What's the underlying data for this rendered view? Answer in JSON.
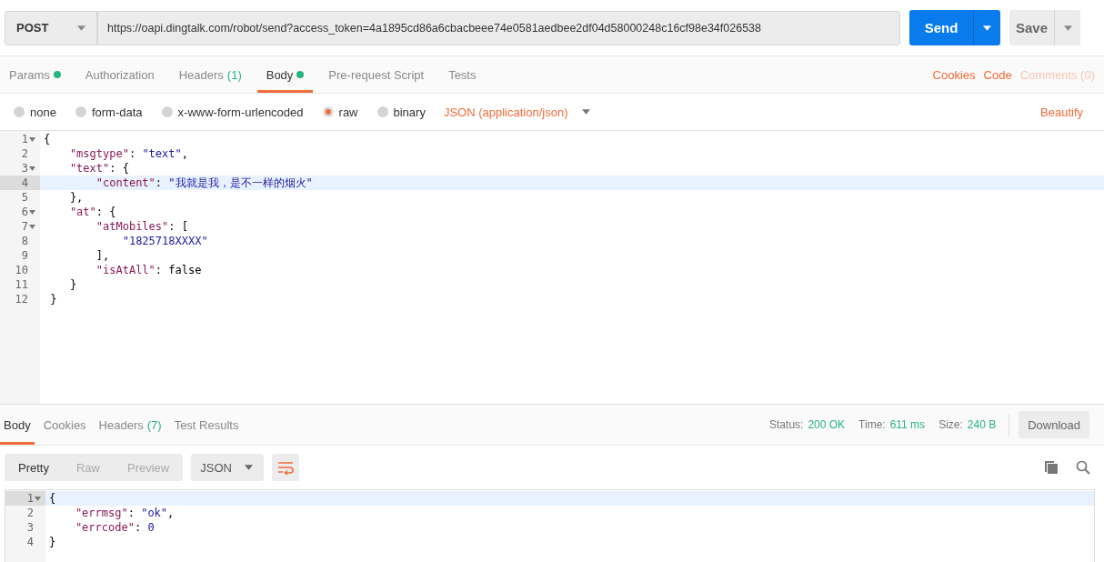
{
  "request_bar": {
    "method": "POST",
    "url": "https://oapi.dingtalk.com/robot/send?access_token=4a1895cd86a6cbacbeee74e0581aedbee2df04d58000248c16cf98e34f026538",
    "send": "Send",
    "save": "Save"
  },
  "request_tabs": [
    {
      "label": "Params",
      "dot": true,
      "selected": false
    },
    {
      "label": "Authorization",
      "dot": false,
      "selected": false
    },
    {
      "label": "Headers",
      "count": "(1)",
      "dot": false,
      "selected": false
    },
    {
      "label": "Body",
      "dot": true,
      "selected": true
    },
    {
      "label": "Pre-request Script",
      "dot": false,
      "selected": false
    },
    {
      "label": "Tests",
      "dot": false,
      "selected": false
    }
  ],
  "request_links": [
    {
      "label": "Cookies",
      "disabled": false
    },
    {
      "label": "Code",
      "disabled": false
    },
    {
      "label": "Comments (0)",
      "disabled": true
    }
  ],
  "body_types": [
    {
      "label": "none",
      "selected": false
    },
    {
      "label": "form-data",
      "selected": false
    },
    {
      "label": "x-www-form-urlencoded",
      "selected": false
    },
    {
      "label": "raw",
      "selected": true
    },
    {
      "label": "binary",
      "selected": false
    }
  ],
  "content_type": "JSON (application/json)",
  "beautify": "Beautify",
  "request_editor": {
    "lines": [
      {
        "number": "1",
        "fold": true,
        "active": false,
        "tokens": [
          {
            "kind": "punct",
            "text": "{"
          }
        ]
      },
      {
        "number": "2",
        "fold": false,
        "active": false,
        "tokens": [
          {
            "kind": "key",
            "text": "    \"msgtype\""
          },
          {
            "kind": "punct",
            "text": ": "
          },
          {
            "kind": "str",
            "text": "\"text\""
          },
          {
            "kind": "punct",
            "text": ","
          }
        ]
      },
      {
        "number": "3",
        "fold": true,
        "active": false,
        "tokens": [
          {
            "kind": "key",
            "text": "    \"text\""
          },
          {
            "kind": "punct",
            "text": ": {"
          }
        ]
      },
      {
        "number": "4",
        "fold": false,
        "active": true,
        "tokens": [
          {
            "kind": "key",
            "text": "        \"content\""
          },
          {
            "kind": "punct",
            "text": ": "
          },
          {
            "kind": "str",
            "text": "\"我就是我，是不一样的烟火\""
          }
        ]
      },
      {
        "number": "5",
        "fold": false,
        "active": false,
        "tokens": [
          {
            "kind": "punct",
            "text": "    },"
          }
        ]
      },
      {
        "number": "6",
        "fold": true,
        "active": false,
        "tokens": [
          {
            "kind": "key",
            "text": "    \"at\""
          },
          {
            "kind": "punct",
            "text": ": {"
          }
        ]
      },
      {
        "number": "7",
        "fold": true,
        "active": false,
        "tokens": [
          {
            "kind": "key",
            "text": "        \"atMobiles\""
          },
          {
            "kind": "punct",
            "text": ": ["
          }
        ]
      },
      {
        "number": "8",
        "fold": false,
        "active": false,
        "tokens": [
          {
            "kind": "str",
            "text": "            \"1825718XXXX\""
          }
        ]
      },
      {
        "number": "9",
        "fold": false,
        "active": false,
        "tokens": [
          {
            "kind": "punct",
            "text": "        ],"
          }
        ]
      },
      {
        "number": "10",
        "fold": false,
        "active": false,
        "tokens": [
          {
            "kind": "key",
            "text": "        \"isAtAll\""
          },
          {
            "kind": "punct",
            "text": ": "
          },
          {
            "kind": "bool",
            "text": "false"
          }
        ]
      },
      {
        "number": "11",
        "fold": false,
        "active": false,
        "tokens": [
          {
            "kind": "punct",
            "text": "    }"
          }
        ]
      },
      {
        "number": "12",
        "fold": false,
        "active": false,
        "tokens": [
          {
            "kind": "punct",
            "text": " }"
          }
        ]
      }
    ]
  },
  "response_tabs": [
    {
      "label": "Body",
      "selected": true
    },
    {
      "label": "Cookies",
      "selected": false
    },
    {
      "label": "Headers",
      "count": "(7)",
      "selected": false
    },
    {
      "label": "Test Results",
      "selected": false
    }
  ],
  "response_stats": [
    {
      "label": "Status:",
      "value": "200 OK"
    },
    {
      "label": "Time:",
      "value": "611 ms"
    },
    {
      "label": "Size:",
      "value": "240 B"
    }
  ],
  "download": "Download",
  "view_modes": [
    {
      "label": "Pretty",
      "selected": true
    },
    {
      "label": "Raw",
      "selected": false
    },
    {
      "label": "Preview",
      "selected": false
    }
  ],
  "format": "JSON",
  "response_editor": {
    "lines": [
      {
        "number": "1",
        "fold": true,
        "active": true,
        "tokens": [
          {
            "kind": "punct",
            "text": "{"
          }
        ]
      },
      {
        "number": "2",
        "fold": false,
        "active": false,
        "tokens": [
          {
            "kind": "key",
            "text": "    \"errmsg\""
          },
          {
            "kind": "punct",
            "text": ": "
          },
          {
            "kind": "str",
            "text": "\"ok\""
          },
          {
            "kind": "punct",
            "text": ","
          }
        ]
      },
      {
        "number": "3",
        "fold": false,
        "active": false,
        "tokens": [
          {
            "kind": "key",
            "text": "    \"errcode\""
          },
          {
            "kind": "punct",
            "text": ": "
          },
          {
            "kind": "num",
            "text": "0"
          }
        ]
      },
      {
        "number": "4",
        "fold": false,
        "active": false,
        "tokens": [
          {
            "kind": "punct",
            "text": "}"
          }
        ]
      }
    ]
  }
}
